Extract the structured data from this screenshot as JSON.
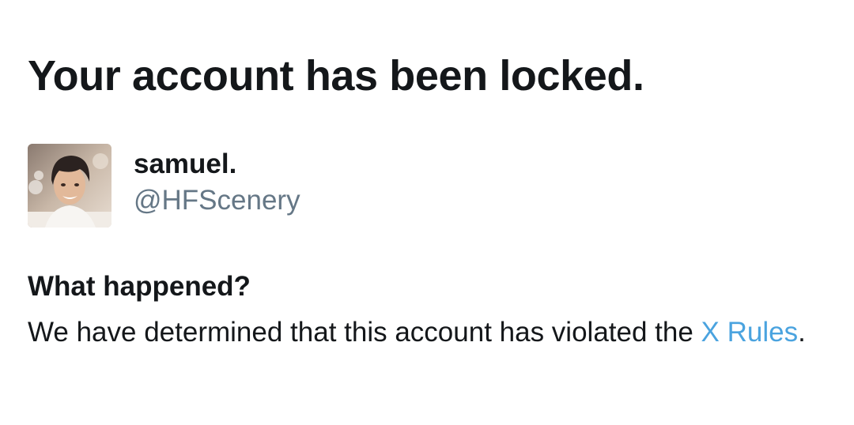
{
  "title": "Your account has been locked.",
  "account": {
    "display_name": "samuel.",
    "handle": "@HFScenery"
  },
  "section": {
    "heading": "What happened?",
    "body_prefix": "We have determined that this account has violated the ",
    "link_text": "X Rules",
    "body_suffix": "."
  },
  "colors": {
    "text": "#14171a",
    "secondary": "#657786",
    "link": "#4aa3df"
  }
}
